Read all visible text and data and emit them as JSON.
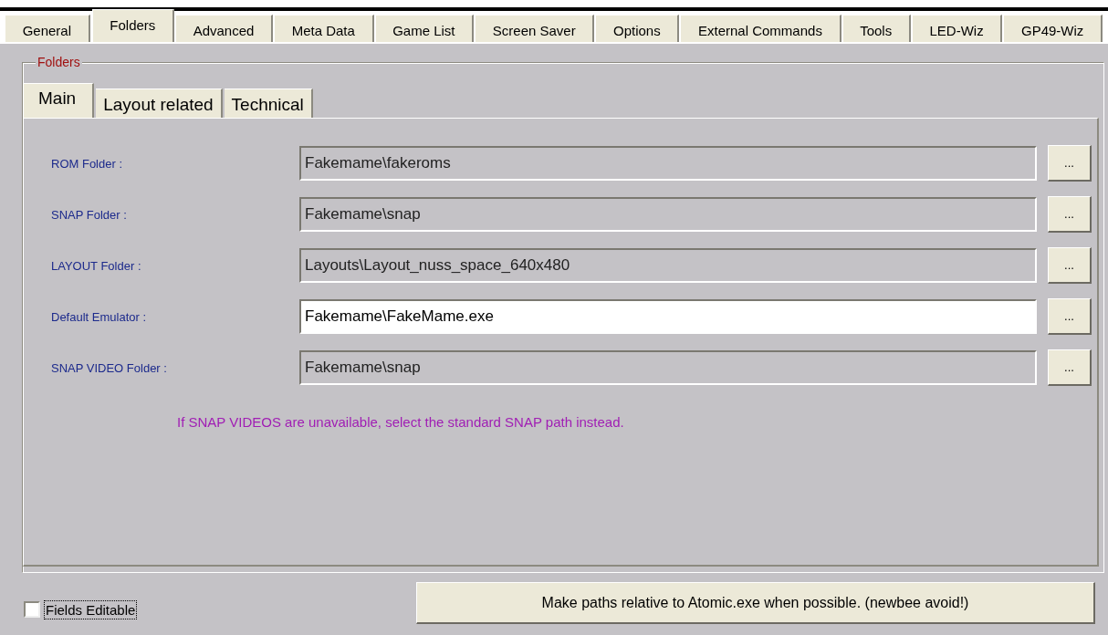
{
  "tabs": [
    {
      "label": "General",
      "selected": false
    },
    {
      "label": "Folders",
      "selected": true
    },
    {
      "label": "Advanced",
      "selected": false
    },
    {
      "label": "Meta Data",
      "selected": false
    },
    {
      "label": "Game List",
      "selected": false
    },
    {
      "label": "Screen Saver",
      "selected": false
    },
    {
      "label": "Options",
      "selected": false
    },
    {
      "label": "External Commands",
      "selected": false
    },
    {
      "label": "Tools",
      "selected": false
    },
    {
      "label": "LED-Wiz",
      "selected": false
    },
    {
      "label": "GP49-Wiz",
      "selected": false
    }
  ],
  "group": {
    "title": "Folders",
    "subtabs": [
      {
        "label": "Main",
        "selected": true
      },
      {
        "label": "Layout related",
        "selected": false
      },
      {
        "label": "Technical",
        "selected": false
      }
    ],
    "rows": [
      {
        "label": "ROM Folder :",
        "value": "Fakemame\\fakeroms",
        "disabled": true,
        "button": "..."
      },
      {
        "label": "SNAP Folder :",
        "value": "Fakemame\\snap",
        "disabled": true,
        "button": "..."
      },
      {
        "label": "LAYOUT Folder :",
        "value": "Layouts\\Layout_nuss_space_640x480",
        "disabled": true,
        "button": "..."
      },
      {
        "label": "Default Emulator :",
        "value": "Fakemame\\FakeMame.exe",
        "disabled": false,
        "button": "..."
      },
      {
        "label": "SNAP VIDEO Folder :",
        "value": "Fakemame\\snap",
        "disabled": true,
        "button": "..."
      }
    ],
    "note": "If SNAP VIDEOS are unavailable, select the standard SNAP path instead."
  },
  "fields_editable": {
    "label": "Fields Editable",
    "checked": false
  },
  "relative_button": "Make paths relative to Atomic.exe when possible. (newbee avoid!)"
}
